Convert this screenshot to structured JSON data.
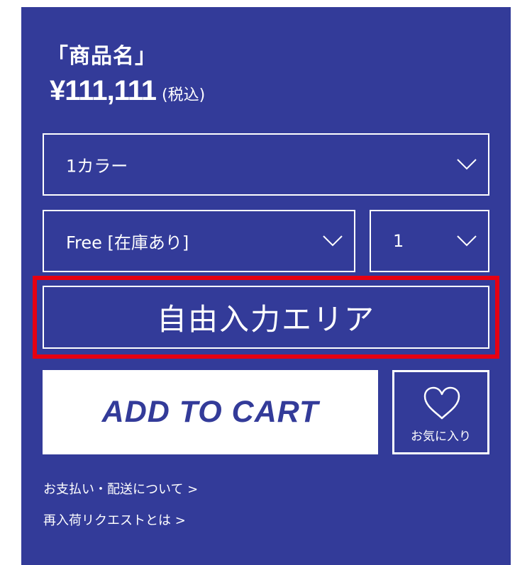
{
  "product": {
    "name": "「商品名」",
    "price": "¥111,111",
    "tax_note": "(税込)"
  },
  "selects": {
    "color": "1カラー",
    "size": "Free [在庫あり]",
    "quantity": "1",
    "chevron_icon": "chevron-down-icon"
  },
  "free_area": {
    "label": "自由入力エリア",
    "highlight_color": "#e60012"
  },
  "actions": {
    "add_to_cart": "ADD TO CART",
    "favorite_label": "お気に入り",
    "favorite_icon": "heart-icon"
  },
  "links": {
    "payment_delivery": "お支払い・配送について >",
    "restock_request": "再入荷リクエストとは >"
  },
  "colors": {
    "panel_background": "#333b99",
    "text": "#ffffff",
    "button_text": "#333b99"
  }
}
